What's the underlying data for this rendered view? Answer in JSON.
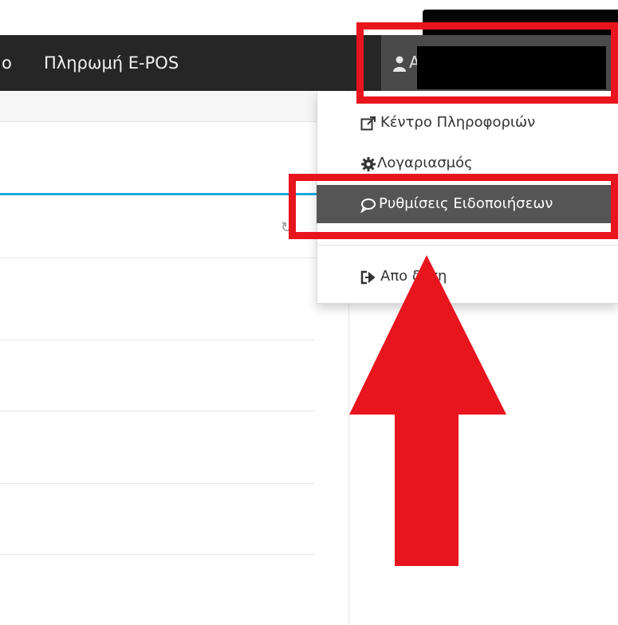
{
  "navbar": {
    "partial_item": "o",
    "item_payment": "Πληρωμή E-POS",
    "user_initial_partial": "A",
    "user_icon": "user-icon",
    "caret_icon": "caret-down-icon"
  },
  "dropdown": {
    "items": [
      {
        "label": "Κέντρο Πληροφοριών",
        "icon": "external-link-icon"
      },
      {
        "label": "Λογαριασμός",
        "icon": "gear-icon"
      },
      {
        "label": "Ρυθμίσεις Ειδοποιήσεων",
        "icon": "speech-bubble-icon",
        "active": true
      },
      {
        "label": "Αποσύνδεση",
        "visible_label": "Απο  δεση",
        "icon": "sign-out-icon"
      }
    ]
  },
  "content": {
    "refresh_icon": "refresh-icon"
  },
  "colors": {
    "navbar": "#262626",
    "user_button": "#4a4a4a",
    "active_menu": "#555555",
    "accent_line": "#1ea6dc",
    "annotation": "#e8141e"
  },
  "annotations": {
    "arrow": "up-arrow",
    "boxes": [
      "user-menu-highlight",
      "notification-settings-highlight"
    ]
  }
}
